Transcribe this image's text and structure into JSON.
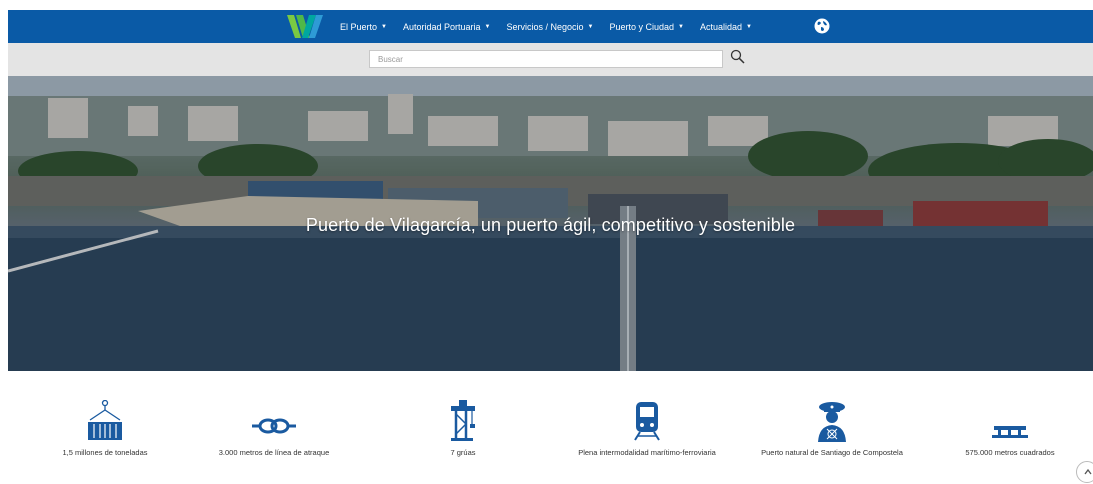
{
  "header": {
    "nav": [
      {
        "label": "El Puerto"
      },
      {
        "label": "Autoridad Portuaria"
      },
      {
        "label": "Servicios / Negocio"
      },
      {
        "label": "Puerto y Ciudad"
      },
      {
        "label": "Actualidad"
      }
    ]
  },
  "search": {
    "placeholder": "Buscar"
  },
  "hero": {
    "title": "Puerto de Vilagarcía, un puerto ágil, competitivo y sostenible"
  },
  "stats": [
    {
      "icon": "container-icon",
      "label": "1,5 millones de toneladas"
    },
    {
      "icon": "rope-knot-icon",
      "label": "3.000 metros de línea de atraque"
    },
    {
      "icon": "crane-icon",
      "label": "7 grúas"
    },
    {
      "icon": "train-icon",
      "label": "Plena intermodalidad marítimo-ferroviaria"
    },
    {
      "icon": "captain-icon",
      "label": "Puerto natural de Santiago de Compostela"
    },
    {
      "icon": "pier-icon",
      "label": "575.000 metros cuadrados"
    }
  ],
  "colors": {
    "brand_blue": "#0a5aa6",
    "logo_green": "#7ac943",
    "icon_blue": "#1a5aa0"
  }
}
